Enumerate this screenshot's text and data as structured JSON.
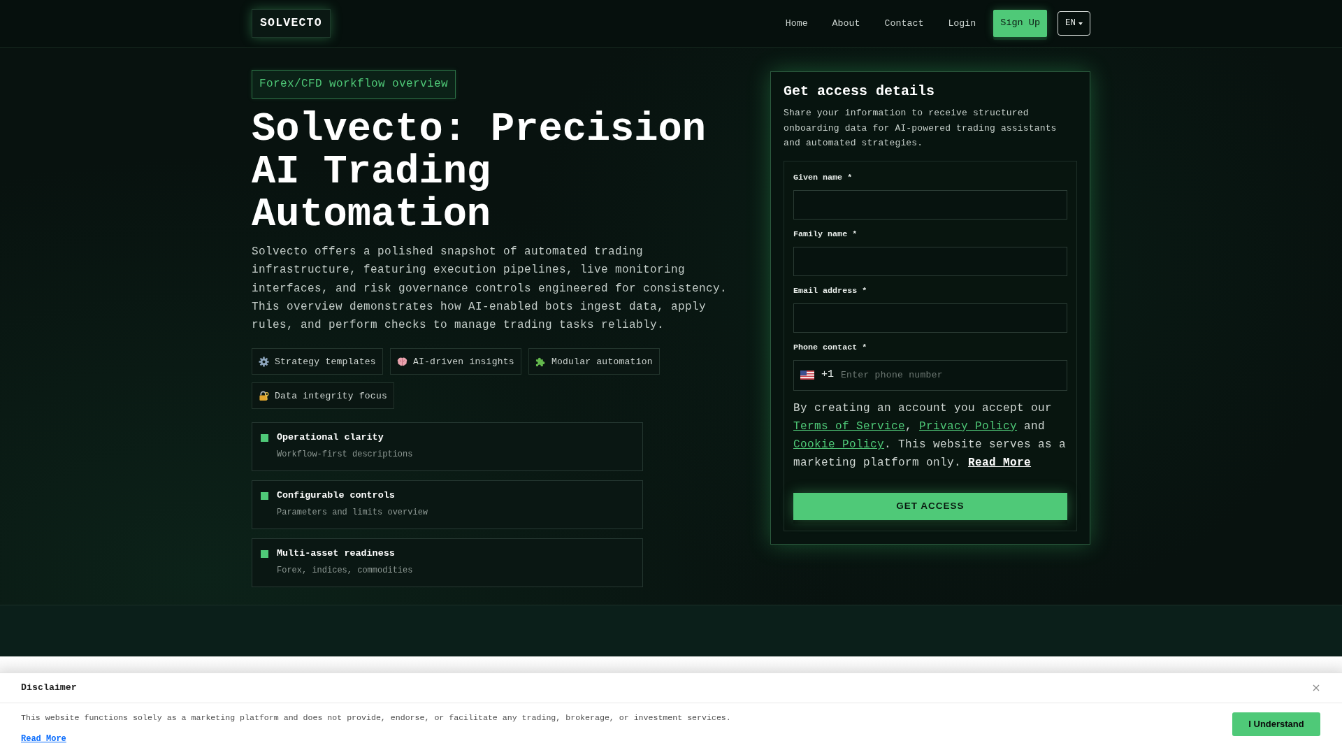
{
  "header": {
    "logo": "SOLVECTO",
    "nav": [
      "Home",
      "About",
      "Contact",
      "Login"
    ],
    "signup_button": "Sign Up",
    "language": "EN"
  },
  "hero": {
    "badge": "Forex/CFD workflow overview",
    "title": "Solvecto: Precision AI Trading Automation",
    "description": "Solvecto offers a polished snapshot of automated trading infrastructure, featuring execution pipelines, live monitoring interfaces, and risk governance controls engineered for consistency. This overview demonstrates how AI-enabled bots ingest data, apply rules, and perform checks to manage trading tasks reliably.",
    "chips": [
      "Strategy templates",
      "AI-driven insights",
      "Modular automation",
      "Data integrity focus"
    ],
    "features": [
      {
        "title": "Operational clarity",
        "subtitle": "Workflow-first descriptions"
      },
      {
        "title": "Configurable controls",
        "subtitle": "Parameters and limits overview"
      },
      {
        "title": "Multi-asset readiness",
        "subtitle": "Forex, indices, commodities"
      }
    ]
  },
  "form": {
    "title": "Get access details",
    "description": "Share your information to receive structured onboarding data for AI-powered trading assistants and automated strategies.",
    "fields": [
      {
        "kind": "text",
        "label": "Given name *"
      },
      {
        "kind": "text",
        "label": "Family name *"
      },
      {
        "kind": "text",
        "label": "Email address *"
      },
      {
        "kind": "phone",
        "label": "Phone contact *",
        "dial_code": "+1",
        "placeholder": "Enter phone number"
      }
    ],
    "consent": [
      {
        "kind": "text",
        "text": "By creating an account you accept our "
      },
      {
        "kind": "link",
        "text": "Terms of Service"
      },
      {
        "kind": "text",
        "text": ", "
      },
      {
        "kind": "link",
        "text": "Privacy Policy"
      },
      {
        "kind": "text",
        "text": " and "
      },
      {
        "kind": "link",
        "text": "Cookie Policy"
      },
      {
        "kind": "text",
        "text": ". This website serves as a marketing platform only. "
      },
      {
        "kind": "strong_link",
        "text": "Read More"
      }
    ],
    "submit": "GET ACCESS"
  },
  "disclaimer": {
    "title": "Disclaimer",
    "text": "This website functions solely as a marketing platform and does not provide, endorse, or facilitate any trading, brokerage, or investment services.",
    "link": "Read More",
    "button": "I Understand"
  }
}
